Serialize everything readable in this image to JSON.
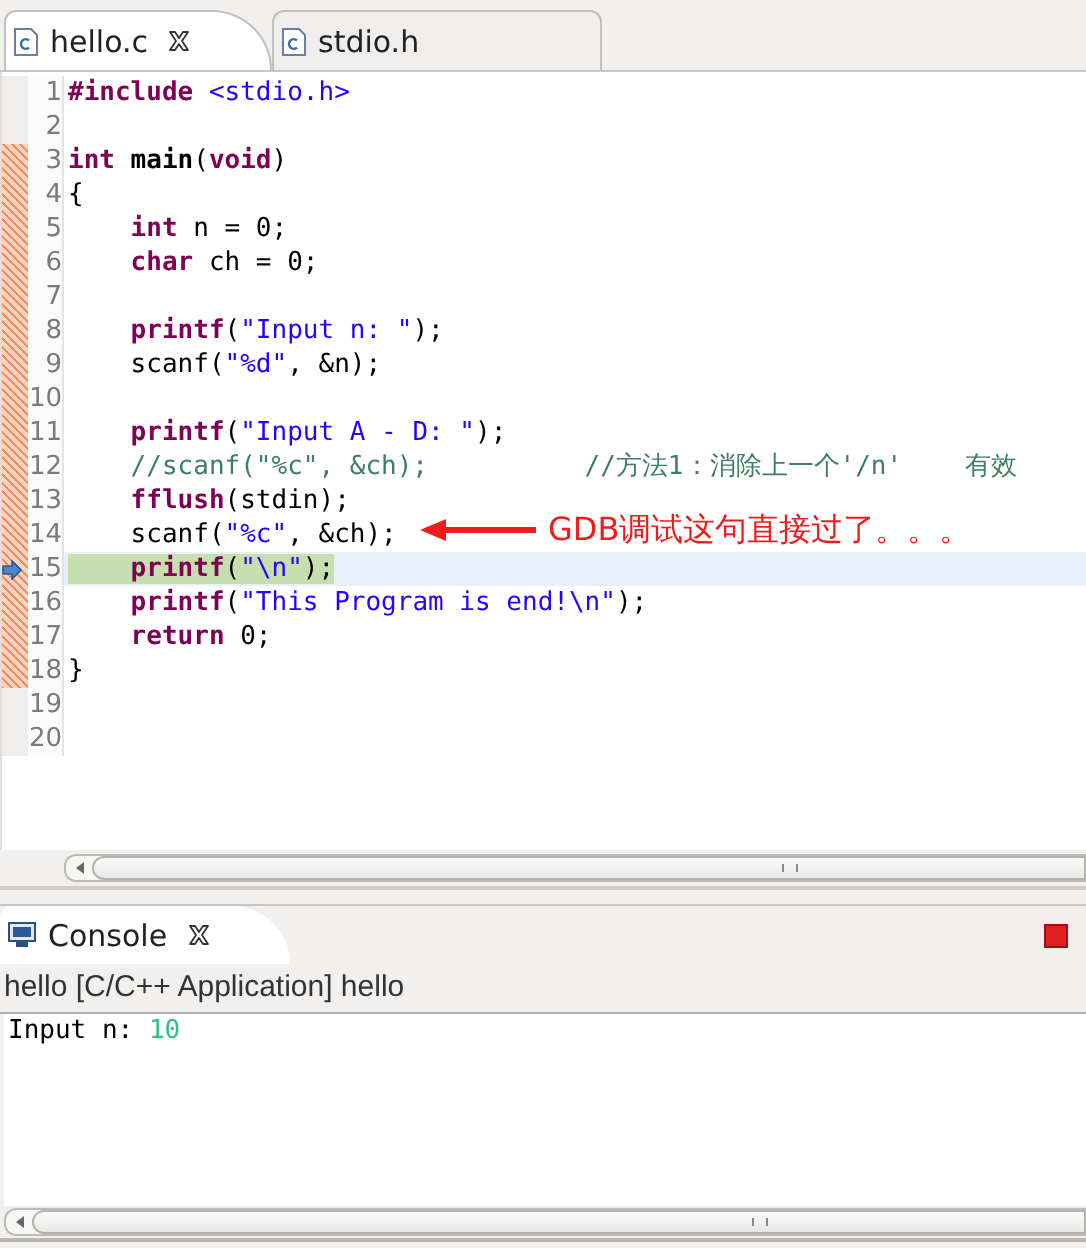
{
  "editor": {
    "tabs": [
      {
        "label": "hello.c",
        "selected": true
      },
      {
        "label": "stdio.h",
        "selected": false
      }
    ],
    "lines": [
      {
        "number": "1",
        "changed": false,
        "current": false,
        "tokens": [
          {
            "kind": "kw",
            "text": "#include"
          },
          {
            "kind": "inc",
            "text": " <stdio.h>"
          }
        ]
      },
      {
        "number": "2",
        "changed": false,
        "current": false
      },
      {
        "number": "3",
        "changed": true,
        "current": false,
        "tokens": [
          {
            "kind": "kw",
            "text": "int"
          },
          {
            "kind": "fn",
            "text": " main"
          },
          {
            "kind": "plain",
            "text": "("
          },
          {
            "kind": "kw",
            "text": "void"
          },
          {
            "kind": "plain",
            "text": ")"
          }
        ]
      },
      {
        "number": "4",
        "changed": true,
        "current": false,
        "tokens": [
          {
            "kind": "plain",
            "text": "{"
          }
        ]
      },
      {
        "number": "5",
        "changed": true,
        "current": false,
        "tokens": [
          {
            "kind": "kw",
            "text": "    int"
          },
          {
            "kind": "plain",
            "text": " n = 0;"
          }
        ]
      },
      {
        "number": "6",
        "changed": true,
        "current": false,
        "tokens": [
          {
            "kind": "kw",
            "text": "    char"
          },
          {
            "kind": "plain",
            "text": " ch = 0;"
          }
        ]
      },
      {
        "number": "7",
        "changed": true,
        "current": false
      },
      {
        "number": "8",
        "changed": true,
        "current": false,
        "tokens": [
          {
            "kind": "kw",
            "text": "    printf"
          },
          {
            "kind": "plain",
            "text": "("
          },
          {
            "kind": "str",
            "text": "\"Input n: \""
          },
          {
            "kind": "plain",
            "text": ");"
          }
        ]
      },
      {
        "number": "9",
        "changed": true,
        "current": false,
        "tokens": [
          {
            "kind": "plain",
            "text": "    scanf("
          },
          {
            "kind": "str",
            "text": "\"%d\""
          },
          {
            "kind": "plain",
            "text": ", &n);"
          }
        ]
      },
      {
        "number": "10",
        "changed": true,
        "current": false
      },
      {
        "number": "11",
        "changed": true,
        "current": false,
        "tokens": [
          {
            "kind": "kw",
            "text": "    printf"
          },
          {
            "kind": "plain",
            "text": "("
          },
          {
            "kind": "str",
            "text": "\"Input A - D: \""
          },
          {
            "kind": "plain",
            "text": ");"
          }
        ]
      },
      {
        "number": "12",
        "changed": true,
        "current": false,
        "tokens": [
          {
            "kind": "cm",
            "text": "    //scanf(\"%c\", &ch);          //方法1：消除上一个'/n'    有效"
          }
        ]
      },
      {
        "number": "13",
        "changed": true,
        "current": false,
        "tokens": [
          {
            "kind": "kw",
            "text": "    fflush"
          },
          {
            "kind": "plain",
            "text": "(stdin);"
          }
        ]
      },
      {
        "number": "14",
        "changed": true,
        "current": false,
        "tokens": [
          {
            "kind": "plain",
            "text": "    scanf("
          },
          {
            "kind": "str",
            "text": "\"%c\""
          },
          {
            "kind": "plain",
            "text": ", &ch);"
          }
        ],
        "annotation": "GDB调试这句直接过了。。。"
      },
      {
        "number": "15",
        "changed": true,
        "current": true,
        "tokens": [
          {
            "kind": "kw",
            "text": "    printf"
          },
          {
            "kind": "plain",
            "text": "("
          },
          {
            "kind": "str",
            "text": "\"\\n\""
          },
          {
            "kind": "plain",
            "text": ");"
          }
        ]
      },
      {
        "number": "16",
        "changed": true,
        "current": false,
        "tokens": [
          {
            "kind": "kw",
            "text": "    printf"
          },
          {
            "kind": "plain",
            "text": "("
          },
          {
            "kind": "str",
            "text": "\"This Program is end!\\n\""
          },
          {
            "kind": "plain",
            "text": ");"
          }
        ]
      },
      {
        "number": "17",
        "changed": true,
        "current": false,
        "tokens": [
          {
            "kind": "kw",
            "text": "    return"
          },
          {
            "kind": "plain",
            "text": " 0;"
          }
        ]
      },
      {
        "number": "18",
        "changed": true,
        "current": false,
        "tokens": [
          {
            "kind": "plain",
            "text": "}"
          }
        ]
      },
      {
        "number": "19",
        "changed": false,
        "current": false
      },
      {
        "number": "20",
        "changed": false,
        "current": false
      }
    ]
  },
  "console": {
    "tab": {
      "label": "Console"
    },
    "process": "hello [C/C++ Application] hello",
    "output": [
      {
        "kind": "out",
        "text": "Input n: "
      },
      {
        "kind": "in",
        "text": "10"
      }
    ]
  }
}
